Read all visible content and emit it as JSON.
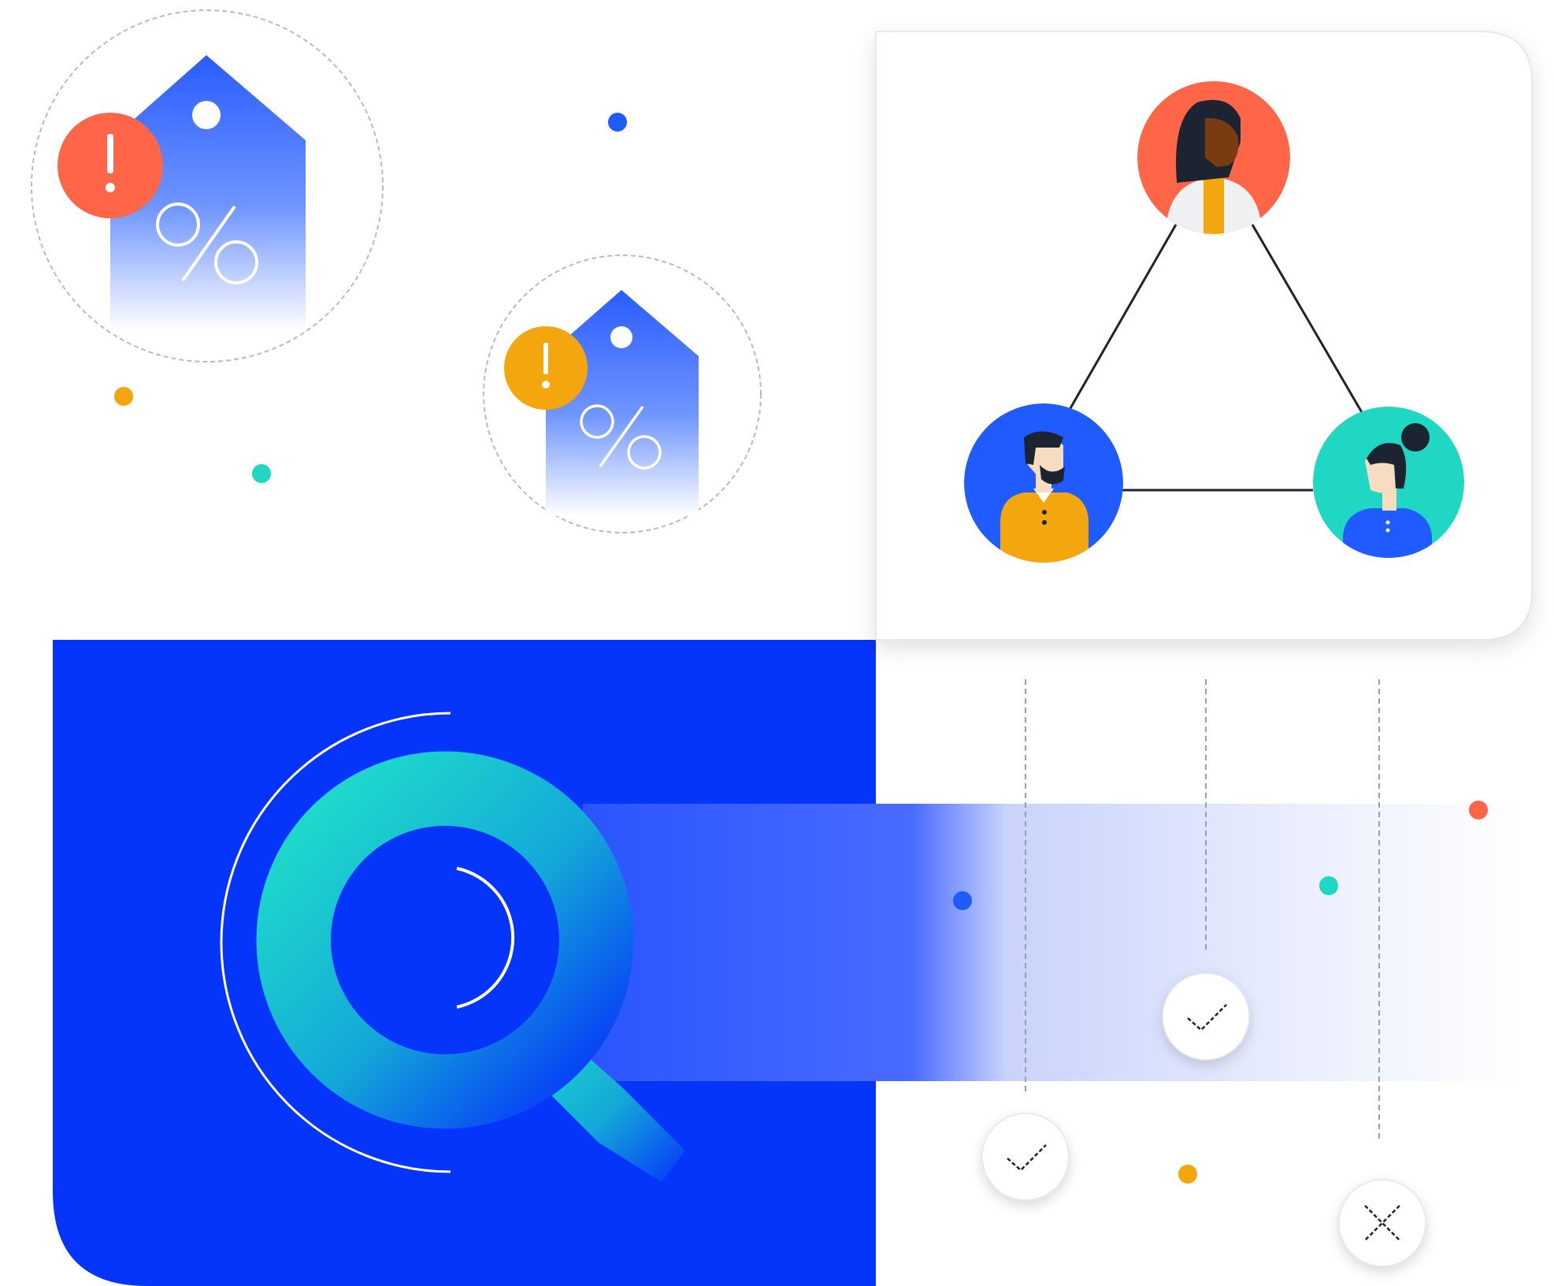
{
  "colors": {
    "background": "#ffffff",
    "brand_blue": "#0534fb",
    "bright_blue": "#1f5bff",
    "coral": "#ff6647",
    "amber": "#f3a60d",
    "teal": "#1fd7c2",
    "ink": "#1c2431",
    "grey_line": "#9aa0a8"
  },
  "illustration": {
    "price_tags": [
      {
        "symbol": "%",
        "alert_symbol": "!",
        "alert_color": "#ff6647"
      },
      {
        "symbol": "%",
        "alert_symbol": "!",
        "alert_color": "#f3a60d"
      }
    ],
    "network_card": {
      "people": [
        {
          "role": "top",
          "background": "#ff6647"
        },
        {
          "role": "bottom-left",
          "background": "#1f5bff"
        },
        {
          "role": "bottom-right",
          "background": "#1fd7c2"
        }
      ]
    },
    "verification_badges": [
      {
        "icon": "check-icon"
      },
      {
        "icon": "check-icon"
      },
      {
        "icon": "cross-icon"
      }
    ]
  }
}
